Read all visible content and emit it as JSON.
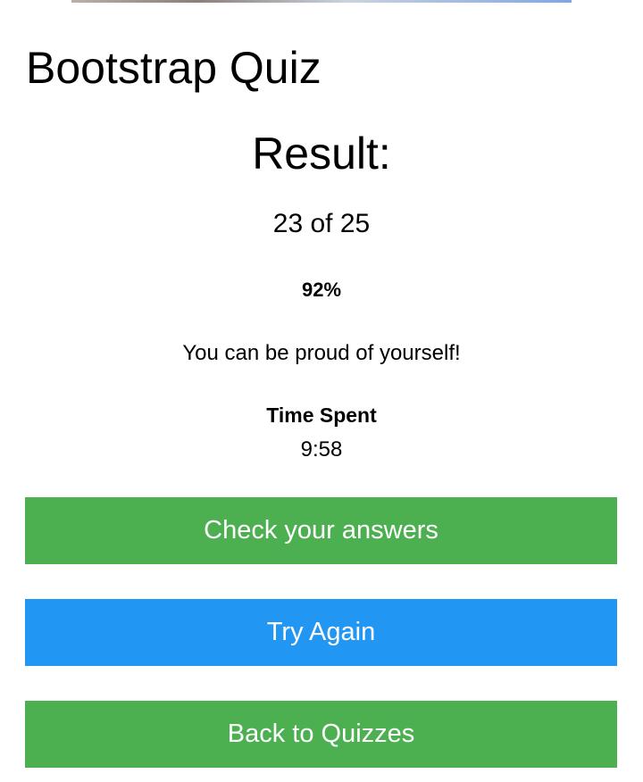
{
  "page": {
    "title": "Bootstrap Quiz"
  },
  "result": {
    "heading": "Result:",
    "score_text": "23 of 25",
    "percent": "92%",
    "message": "You can be proud of yourself!",
    "time_label": "Time Spent",
    "time_value": "9:58"
  },
  "actions": {
    "check_answers": "Check your answers",
    "try_again": "Try Again",
    "back_to_quizzes": "Back to Quizzes"
  },
  "colors": {
    "green": "#4CAF50",
    "blue": "#2196F3",
    "button_text": "#ffffff"
  }
}
